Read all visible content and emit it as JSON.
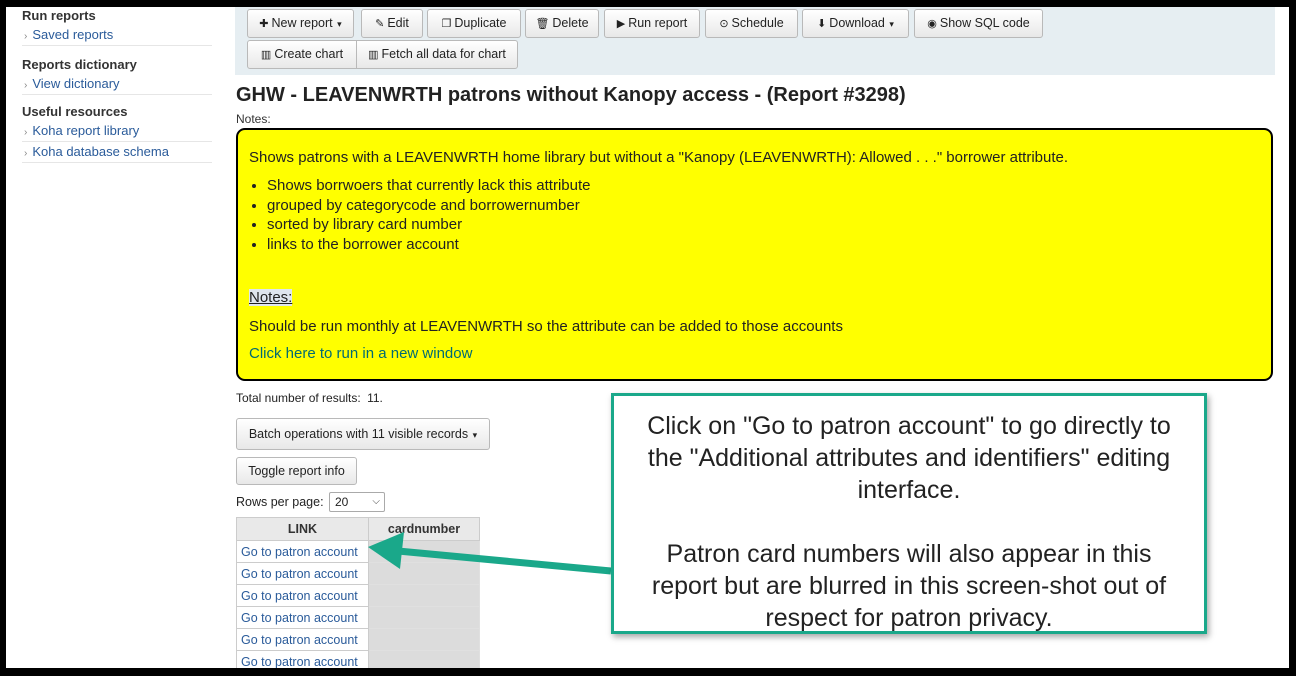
{
  "sidebar": {
    "sections": [
      {
        "heading": "Run reports",
        "items": [
          "Saved reports"
        ]
      },
      {
        "heading": "Reports dictionary",
        "items": [
          "View dictionary"
        ]
      },
      {
        "heading": "Useful resources",
        "items": [
          "Koha report library",
          "Koha database schema"
        ]
      }
    ]
  },
  "toolbar": {
    "new_report": "New report",
    "edit": "Edit",
    "duplicate": "Duplicate",
    "delete": "Delete",
    "run_report": "Run report",
    "schedule": "Schedule",
    "download": "Download",
    "show_sql": "Show SQL code",
    "create_chart": "Create chart",
    "fetch_all": "Fetch all data for chart"
  },
  "report": {
    "title": "GHW - LEAVENWRTH patrons without Kanopy access - (Report #3298)",
    "notes_label": "Notes:",
    "notes_intro": "Shows patrons with a LEAVENWRTH home library but without a \"Kanopy (LEAVENWRTH): Allowed . . .\" borrower attribute.",
    "notes_list": [
      "Shows borrwoers that currently lack this attribute",
      "grouped by categorycode and borrowernumber",
      "sorted by library card number",
      "links to the borrower account"
    ],
    "notes_heading": "Notes:",
    "notes_frequency": "Should be run monthly at LEAVENWRTH so the attribute can be added to those accounts",
    "notes_link": "Click here to run in a new window"
  },
  "results": {
    "total_label": "Total number of results:",
    "total_value": "11.",
    "batch_button": "Batch operations with 11 visible records",
    "toggle_button": "Toggle report info",
    "rows_label": "Rows per page:",
    "rows_value": "20",
    "columns": [
      "LINK",
      "cardnumber"
    ],
    "link_text": "Go to patron account",
    "visible_rows": 6
  },
  "callout": {
    "paragraph1": "Click on \"Go to patron account\" to go directly to the \"Additional attributes and identifiers\" editing interface.",
    "paragraph2": "Patron card numbers will also appear in this report but are blurred in this screen-shot out of respect for patron privacy."
  },
  "colors": {
    "notes_background": "#ffff00",
    "callout_border": "#1aa88a",
    "link": "#2a5b9a",
    "toolbar_background": "#e6eef2"
  }
}
